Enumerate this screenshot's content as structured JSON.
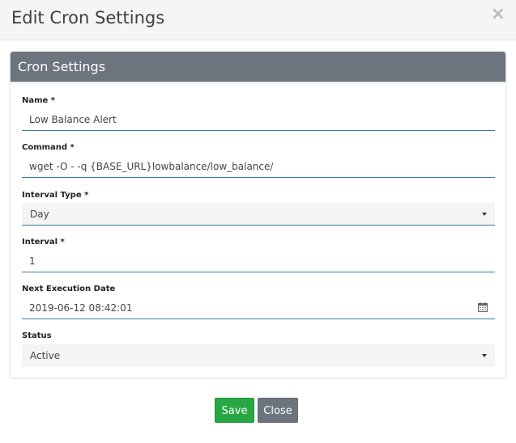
{
  "modal": {
    "title": "Edit Cron Settings",
    "close_symbol": "×"
  },
  "card": {
    "title": "Cron Settings"
  },
  "fields": {
    "name": {
      "label": "Name *",
      "value": "Low Balance Alert"
    },
    "command": {
      "label": "Command *",
      "value": "wget -O - -q {BASE_URL}lowbalance/low_balance/"
    },
    "interval_type": {
      "label": "Interval Type *",
      "value": "Day"
    },
    "interval": {
      "label": "Interval *",
      "value": "1"
    },
    "next_execution_date": {
      "label": "Next Execution Date",
      "value": "2019-06-12 08:42:01",
      "icon": "calendar-icon"
    },
    "status": {
      "label": "Status",
      "value": "Active"
    }
  },
  "buttons": {
    "save": "Save",
    "close": "Close"
  },
  "colors": {
    "save": "#28a745",
    "secondary": "#6c757d",
    "input_underline": "#3a7ca5"
  }
}
